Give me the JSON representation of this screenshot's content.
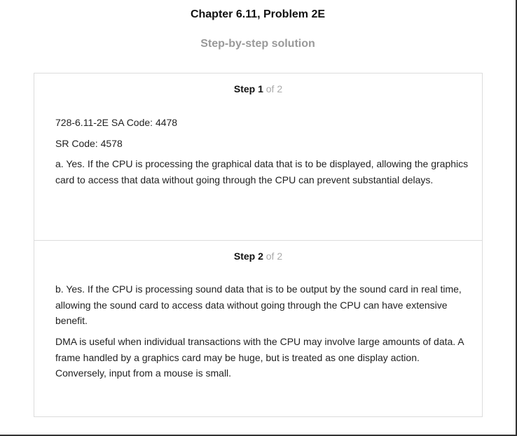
{
  "header": {
    "title": "Chapter 6.11, Problem 2E",
    "subtitle": "Step-by-step solution"
  },
  "steps": [
    {
      "label": "Step 1",
      "of": "of 2",
      "paragraphs": [
        "728-6.11-2E SA Code: 4478",
        "SR Code: 4578",
        "a. Yes. If the CPU is processing the graphical data that is to be displayed, allowing the graphics card to access that data without going through the CPU can prevent substantial delays."
      ]
    },
    {
      "label": "Step 2",
      "of": "of 2",
      "paragraphs": [
        "b. Yes. If the CPU is processing sound data that is to be output by the sound card in real time, allowing the sound card to access data without going through the CPU can have extensive benefit.",
        "DMA is useful when individual transactions with the CPU may involve large amounts of data. A frame handled by a graphics card may be huge, but is treated as one display action. Conversely, input from a mouse is small."
      ]
    }
  ]
}
